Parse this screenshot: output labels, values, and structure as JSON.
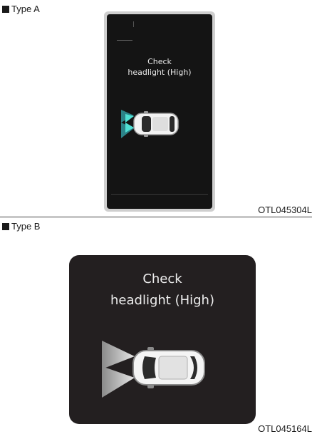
{
  "type_a": {
    "label": "Type A",
    "message_line1": "Check",
    "message_line2": "headlight (High)",
    "code": "OTL045304L",
    "icon": "headlight-warning-car-icon",
    "beam_color": "#3fd0c8"
  },
  "type_b": {
    "label": "Type B",
    "message_line1": "Check",
    "message_line2": "headlight (High)",
    "code": "OTL045164L",
    "icon": "headlight-warning-car-icon",
    "beam_color": "#d9d9d9"
  }
}
